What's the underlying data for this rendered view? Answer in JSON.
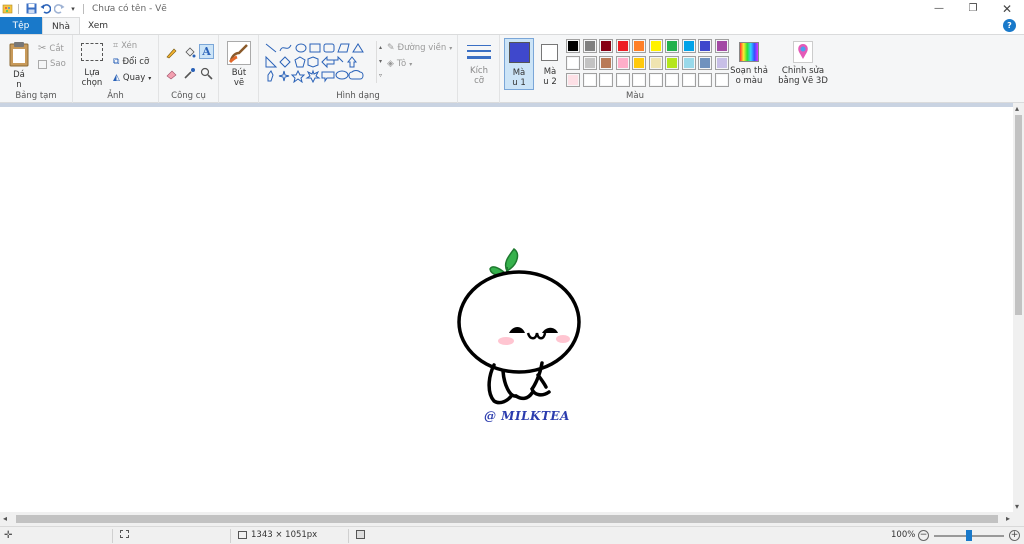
{
  "window": {
    "title": "Chưa có tên - Vẽ",
    "controls": [
      "minimize-icon",
      "restore-icon",
      "close-icon"
    ]
  },
  "tabs": {
    "file": "Tệp",
    "home": "Nhà",
    "view": "Xem"
  },
  "ribbon": {
    "clipboard": {
      "paste_label": "Dá\nn",
      "cut": "Cắt",
      "copy": "Sao",
      "group": "Bảng tạm"
    },
    "image": {
      "select_label": "Lựa\nchọn",
      "crop": "Xén",
      "resize": "Đổi cỡ",
      "rotate": "Quay",
      "group": "Ảnh"
    },
    "tools": {
      "group": "Công cụ"
    },
    "brushes": {
      "label": "Bút\nvẽ"
    },
    "shapes": {
      "outline": "Đường viền",
      "fill": "Tô",
      "group": "Hình dạng"
    },
    "size": {
      "label": "Kích\ncỡ"
    },
    "colors": {
      "color1": "Mà\nu 1",
      "color2": "Mà\nu 2",
      "edit_colors": "Soạn thả\no màu",
      "paint3d": "Chỉnh sửa\nbằng Vẽ 3D",
      "group": "Màu",
      "color1_value": "#3f48cc",
      "color2_value": "#ffffff",
      "palette_row1": [
        "#000000",
        "#7f7f7f",
        "#880015",
        "#ed1c24",
        "#ff7f27",
        "#fff200",
        "#22b14c",
        "#00a2e8",
        "#3f48cc",
        "#a349a4"
      ],
      "palette_row2": [
        "#ffffff",
        "#c3c3c3",
        "#b97a57",
        "#ffaec9",
        "#ffc90e",
        "#efe4b0",
        "#b5e61d",
        "#99d9ea",
        "#7092be",
        "#c8bfe7"
      ],
      "palette_row3": [
        "#fde0e6",
        "#ffffff",
        "#ffffff",
        "#ffffff",
        "#ffffff",
        "#ffffff",
        "#ffffff",
        "#ffffff",
        "#ffffff",
        "#ffffff"
      ]
    }
  },
  "canvas": {
    "watermark": "@ MILKTEA"
  },
  "status": {
    "dimensions": "1343 × 1051px",
    "zoom": "100%"
  }
}
